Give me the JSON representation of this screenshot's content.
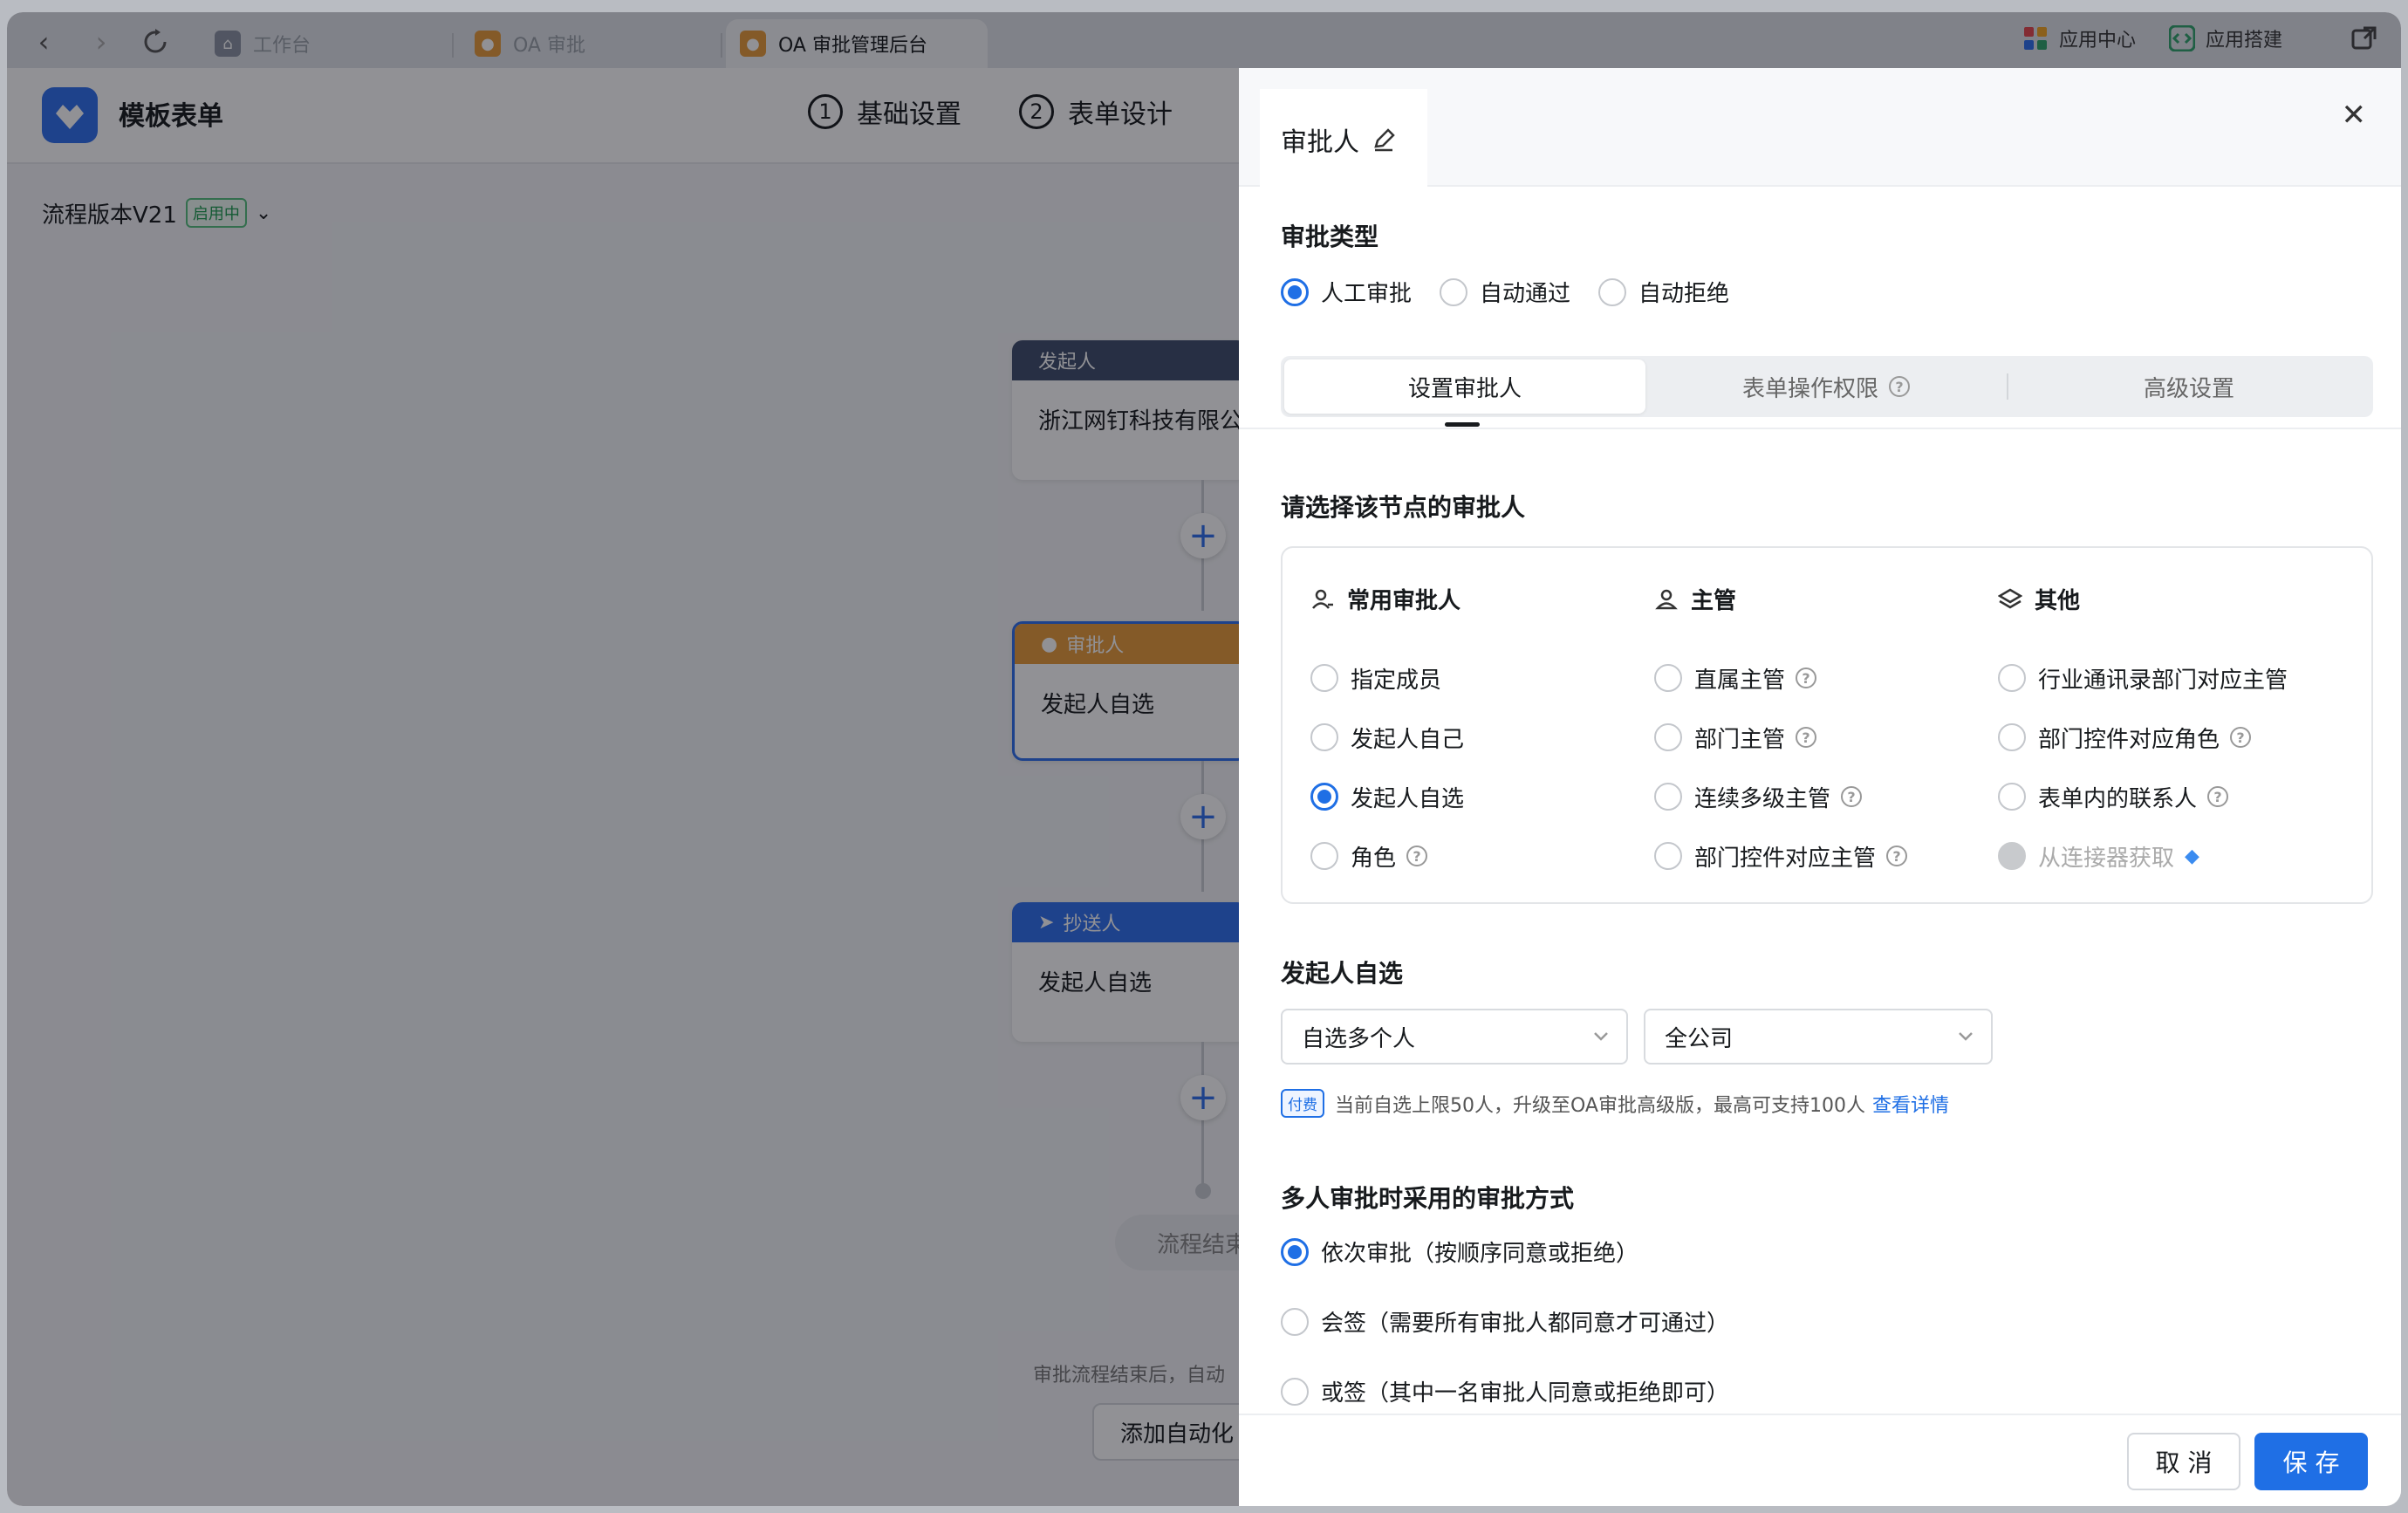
{
  "browser": {
    "tabs": [
      {
        "label": "工作台"
      },
      {
        "label": "OA 审批"
      },
      {
        "label": "OA 审批管理后台"
      }
    ],
    "right": {
      "app_center": "应用中心",
      "app_build": "应用搭建"
    }
  },
  "app": {
    "title": "模板表单",
    "steps": [
      {
        "num": "1",
        "label": "基础设置"
      },
      {
        "num": "2",
        "label": "表单设计"
      }
    ],
    "version": "流程版本V21",
    "version_badge": "启用中"
  },
  "flow": {
    "initiator": {
      "head": "发起人",
      "body": "浙江网钉科技有限公"
    },
    "approver": {
      "head": "审批人",
      "body": "发起人自选"
    },
    "cc": {
      "head": "抄送人",
      "body": "发起人自选"
    },
    "end": "流程结束",
    "end_note": "审批流程结束后，自动",
    "add_auto": "添加自动化"
  },
  "drawer": {
    "title": "审批人",
    "approval_type": {
      "title": "审批类型",
      "options": [
        "人工审批",
        "自动通过",
        "自动拒绝"
      ],
      "selected": "人工审批"
    },
    "segments": [
      "设置审批人",
      "表单操作权限",
      "高级设置"
    ],
    "select_title": "请选择该节点的审批人",
    "columns": [
      {
        "head": "常用审批人",
        "items": [
          "指定成员",
          "发起人自己",
          "发起人自选",
          "角色"
        ]
      },
      {
        "head": "主管",
        "items": [
          "直属主管",
          "部门主管",
          "连续多级主管",
          "部门控件对应主管"
        ]
      },
      {
        "head": "其他",
        "items": [
          "行业通讯录部门对应主管",
          "部门控件对应角色",
          "表单内的联系人",
          "从连接器获取"
        ]
      }
    ],
    "selected_approver": "发起人自选",
    "self_select": {
      "title": "发起人自选",
      "mode": "自选多个人",
      "scope": "全公司",
      "paid_badge": "付费",
      "tip": "当前自选上限50人，升级至OA审批高级版，最高可支持100人",
      "link": "查看详情"
    },
    "multi": {
      "title": "多人审批时采用的审批方式",
      "options": [
        "依次审批（按顺序同意或拒绝）",
        "会签（需要所有审批人都同意才可通过）",
        "或签（其中一名审批人同意或拒绝即可）"
      ],
      "selected": "依次审批（按顺序同意或拒绝）"
    },
    "cancel": "取 消",
    "save": "保 存"
  },
  "colors": {
    "primary": "#1f6fe5",
    "initiator_head": "#3f4d6c",
    "approver_head": "#e89b3a",
    "cc_head": "#2f6fed"
  }
}
